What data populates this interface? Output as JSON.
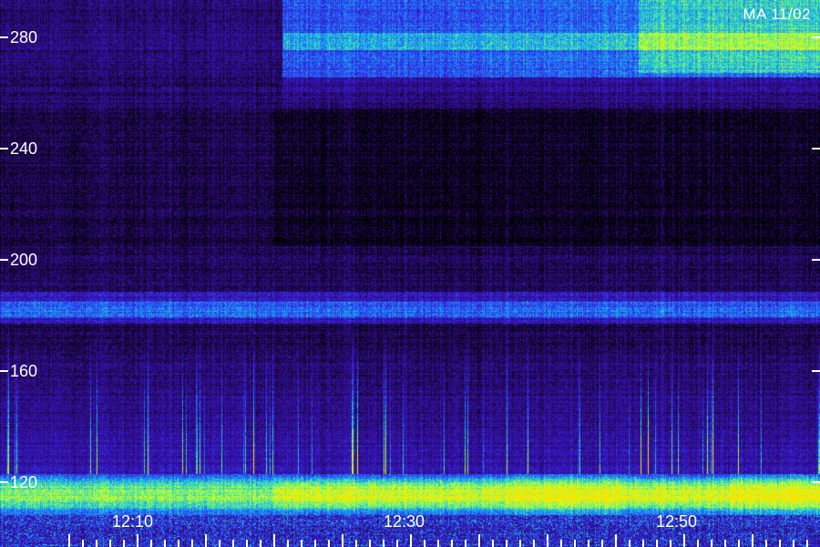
{
  "station_label": "MA 11/02",
  "y_axis": {
    "tick_labels": [
      "280",
      "240",
      "200",
      "160",
      "120"
    ]
  },
  "x_axis": {
    "tick_labels": [
      "12:10",
      "12:30",
      "12:50"
    ]
  },
  "colors": {
    "background": "#000000",
    "colormap": [
      "#000000",
      "#2a0a6e",
      "#3a1ad8",
      "#1a7cff",
      "#27e0c8",
      "#c8ff22",
      "#ffe000"
    ]
  }
}
